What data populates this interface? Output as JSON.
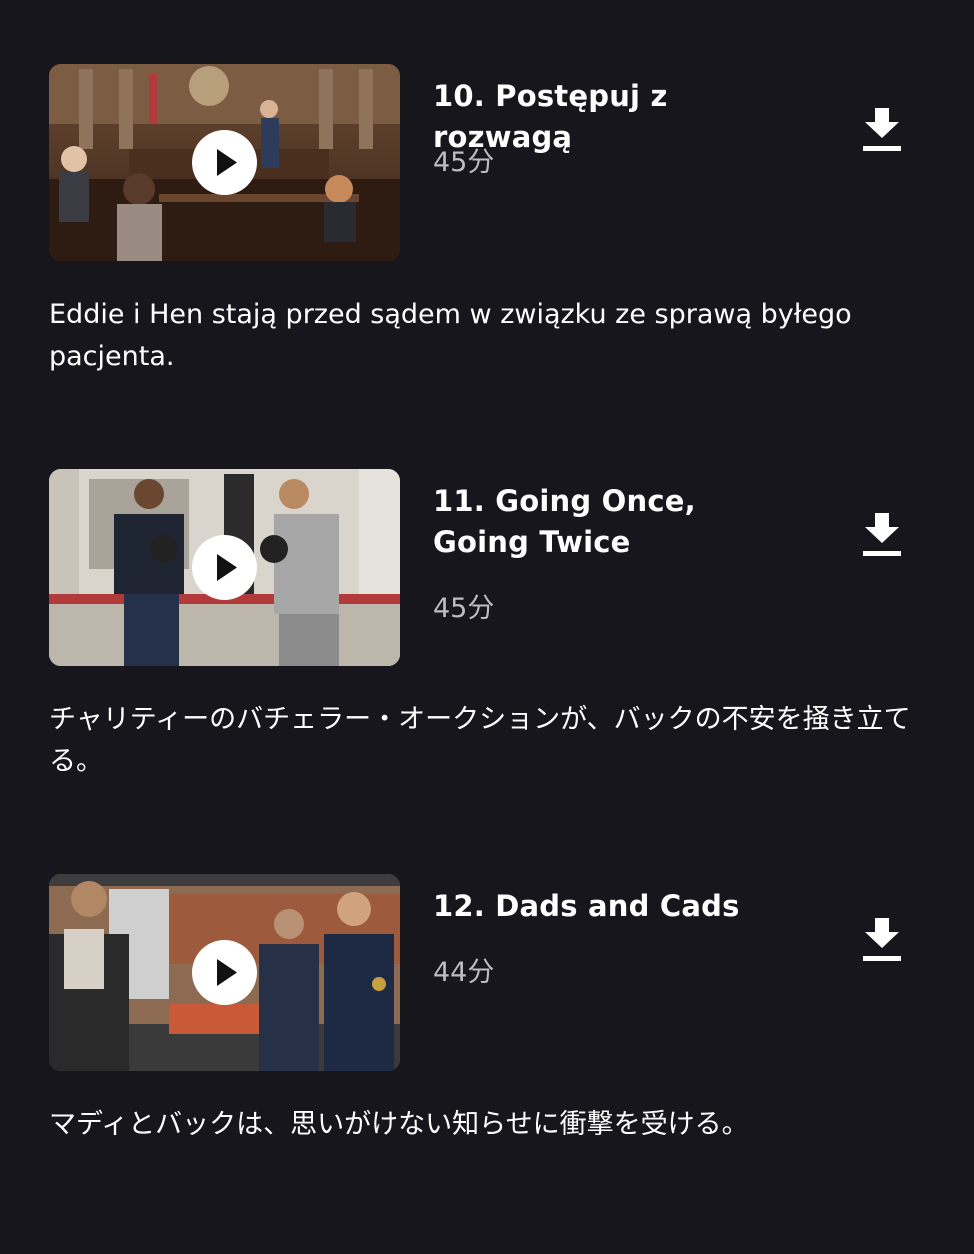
{
  "colors": {
    "background": "#17161c",
    "title": "#ffffff",
    "duration": "#bdbcc4",
    "icon": "#ffffff"
  },
  "episodes": [
    {
      "title": "10. Postępuj z rozwagą",
      "duration": "45分",
      "description": "Eddie i Hen stają przed sądem w związku ze sprawą byłego pacjenta.",
      "thumbnail": "courtroom-scene",
      "play_icon": "play-icon",
      "download_icon": "download-icon"
    },
    {
      "title": "11. Going Once, Going Twice",
      "duration": "45分",
      "description": "チャリティーのバチェラー・オークションが、バックの不安を掻き立てる。",
      "thumbnail": "boxing-gym-scene",
      "play_icon": "play-icon",
      "download_icon": "download-icon"
    },
    {
      "title": "12. Dads and Cads",
      "duration": "44分",
      "description": "マディとバックは、思いがけない知らせに衝撃を受ける。",
      "thumbnail": "firehouse-kitchen-scene",
      "play_icon": "play-icon",
      "download_icon": "download-icon"
    }
  ]
}
